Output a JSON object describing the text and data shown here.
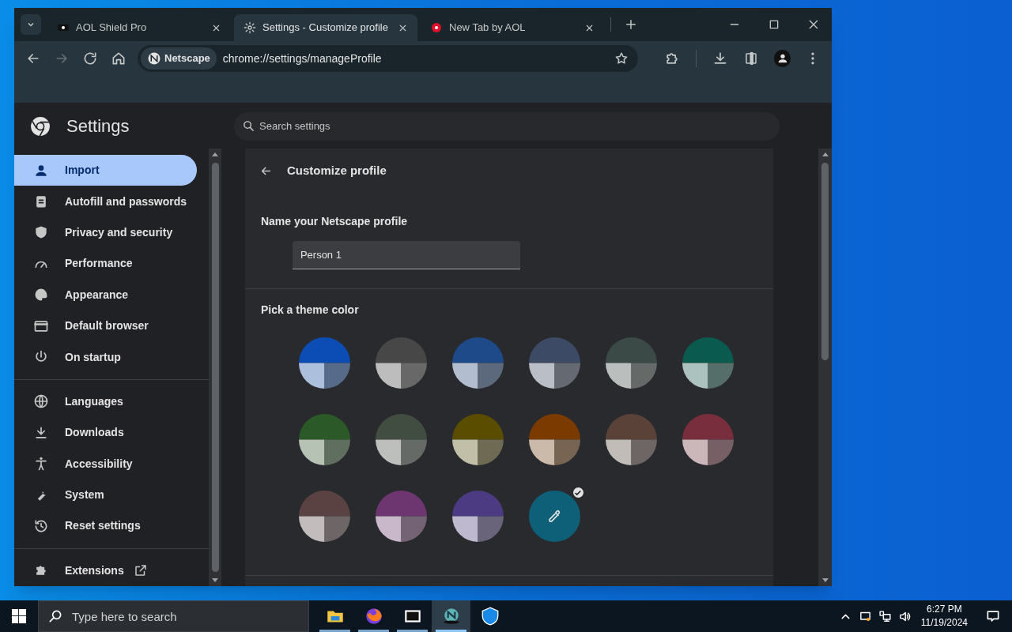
{
  "tabs": [
    {
      "title": "AOL Shield Pro",
      "selected": false
    },
    {
      "title": "Settings - Customize profile",
      "selected": true
    },
    {
      "title": "New Tab by AOL",
      "selected": false
    }
  ],
  "toolbar": {
    "profile_chip": "Netscape",
    "url": "chrome://settings/manageProfile"
  },
  "settings": {
    "title": "Settings",
    "search": {
      "placeholder": "Search settings"
    }
  },
  "sidebar": {
    "groups": [
      [
        {
          "label": "Import",
          "selected": true,
          "kind": "page"
        },
        {
          "label": "Autofill and passwords",
          "selected": false,
          "kind": "page"
        },
        {
          "label": "Privacy and security",
          "selected": false,
          "kind": "page"
        },
        {
          "label": "Performance",
          "selected": false,
          "kind": "page"
        },
        {
          "label": "Appearance",
          "selected": false,
          "kind": "page"
        },
        {
          "label": "Default browser",
          "selected": false,
          "kind": "page"
        },
        {
          "label": "On startup",
          "selected": false,
          "kind": "page"
        }
      ],
      [
        {
          "label": "Languages",
          "selected": false,
          "kind": "page"
        },
        {
          "label": "Downloads",
          "selected": false,
          "kind": "page"
        },
        {
          "label": "Accessibility",
          "selected": false,
          "kind": "page"
        },
        {
          "label": "System",
          "selected": false,
          "kind": "page"
        },
        {
          "label": "Reset settings",
          "selected": false,
          "kind": "page"
        }
      ],
      [
        {
          "label": "Extensions",
          "selected": false,
          "kind": "link"
        }
      ]
    ]
  },
  "page": {
    "title": "Customize profile",
    "name_label": "Name your Netscape profile",
    "name_value": "Person 1",
    "theme_label": "Pick a theme color",
    "theme_colors": [
      {
        "kind": "preset",
        "selected": false,
        "color": "#0b4db5"
      },
      {
        "kind": "preset",
        "selected": false,
        "color": "#474747"
      },
      {
        "kind": "preset",
        "selected": false,
        "color": "#1f4a8a"
      },
      {
        "kind": "preset",
        "selected": false,
        "color": "#3d4a66"
      },
      {
        "kind": "preset",
        "selected": false,
        "color": "#3c4a47"
      },
      {
        "kind": "preset",
        "selected": false,
        "color": "#0b5a4f"
      },
      {
        "kind": "preset",
        "selected": false,
        "color": "#2b5a28"
      },
      {
        "kind": "preset",
        "selected": false,
        "color": "#424d42"
      },
      {
        "kind": "preset",
        "selected": false,
        "color": "#5a4d00"
      },
      {
        "kind": "preset",
        "selected": false,
        "color": "#7a3a00"
      },
      {
        "kind": "preset",
        "selected": false,
        "color": "#5a4239"
      },
      {
        "kind": "preset",
        "selected": false,
        "color": "#782e3d"
      },
      {
        "kind": "preset",
        "selected": false,
        "color": "#5a4242"
      },
      {
        "kind": "preset",
        "selected": false,
        "color": "#6e3670"
      },
      {
        "kind": "preset",
        "selected": false,
        "color": "#4c3a82"
      },
      {
        "kind": "custom",
        "selected": true,
        "color": "#0e6079"
      }
    ]
  },
  "taskbar": {
    "search": {
      "placeholder": "Type here to search"
    },
    "apps": [
      {
        "selected": false
      },
      {
        "selected": false
      },
      {
        "selected": false
      },
      {
        "selected": true
      },
      {
        "selected": false
      }
    ],
    "time": "6:27 PM",
    "date": "11/19/2024"
  }
}
